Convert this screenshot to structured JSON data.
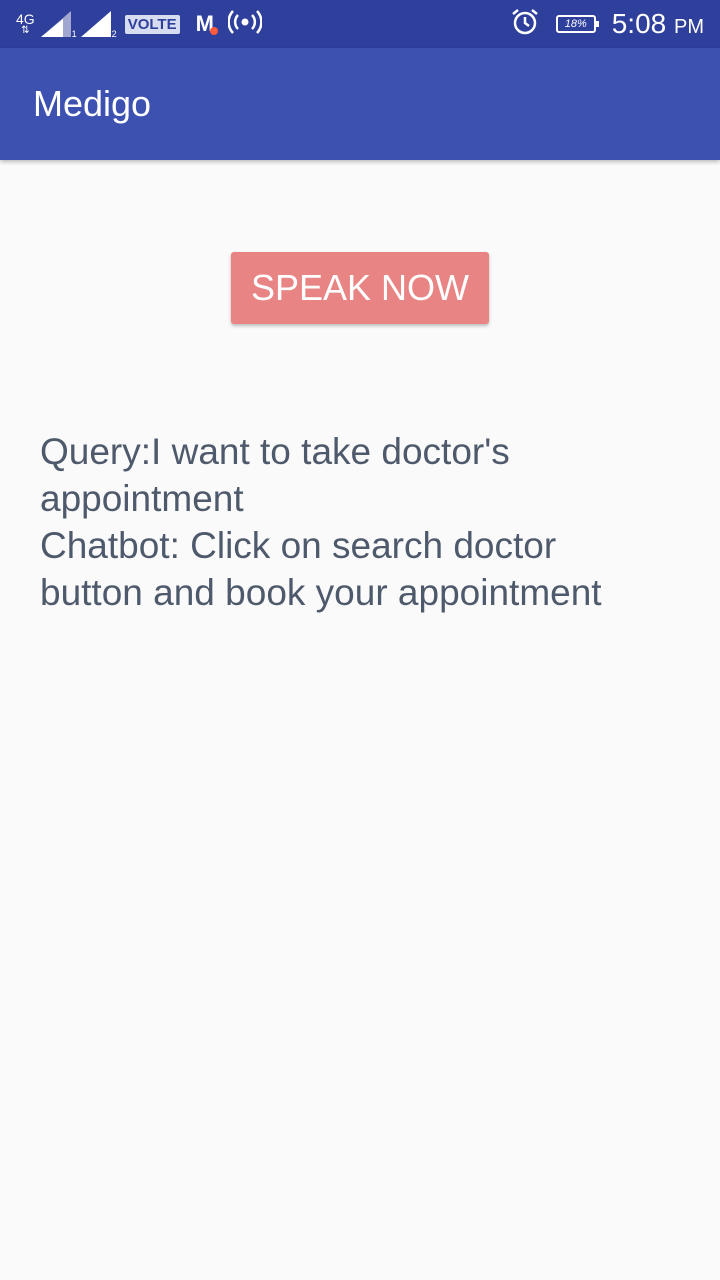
{
  "status_bar": {
    "network_type": "4G",
    "network_arrows": "⇅",
    "sim1_label": "1",
    "sim2_label": "2",
    "volte_label": "VOLTE",
    "carrier_logo": "M",
    "battery_level": "18%",
    "time": "5:08",
    "ampm": "PM",
    "icons": [
      "signal-icon",
      "hotspot-icon",
      "alarm-icon",
      "battery-icon"
    ]
  },
  "app_bar": {
    "title": "Medigo",
    "color": "#3c51b0"
  },
  "main": {
    "speak_button_label": "SPEAK NOW",
    "speak_button_color": "#e88584",
    "chat_lines": [
      "Query:I want to take doctor's",
      "appointment",
      "Chatbot: Click on search doctor",
      "button and book your appointment"
    ]
  }
}
